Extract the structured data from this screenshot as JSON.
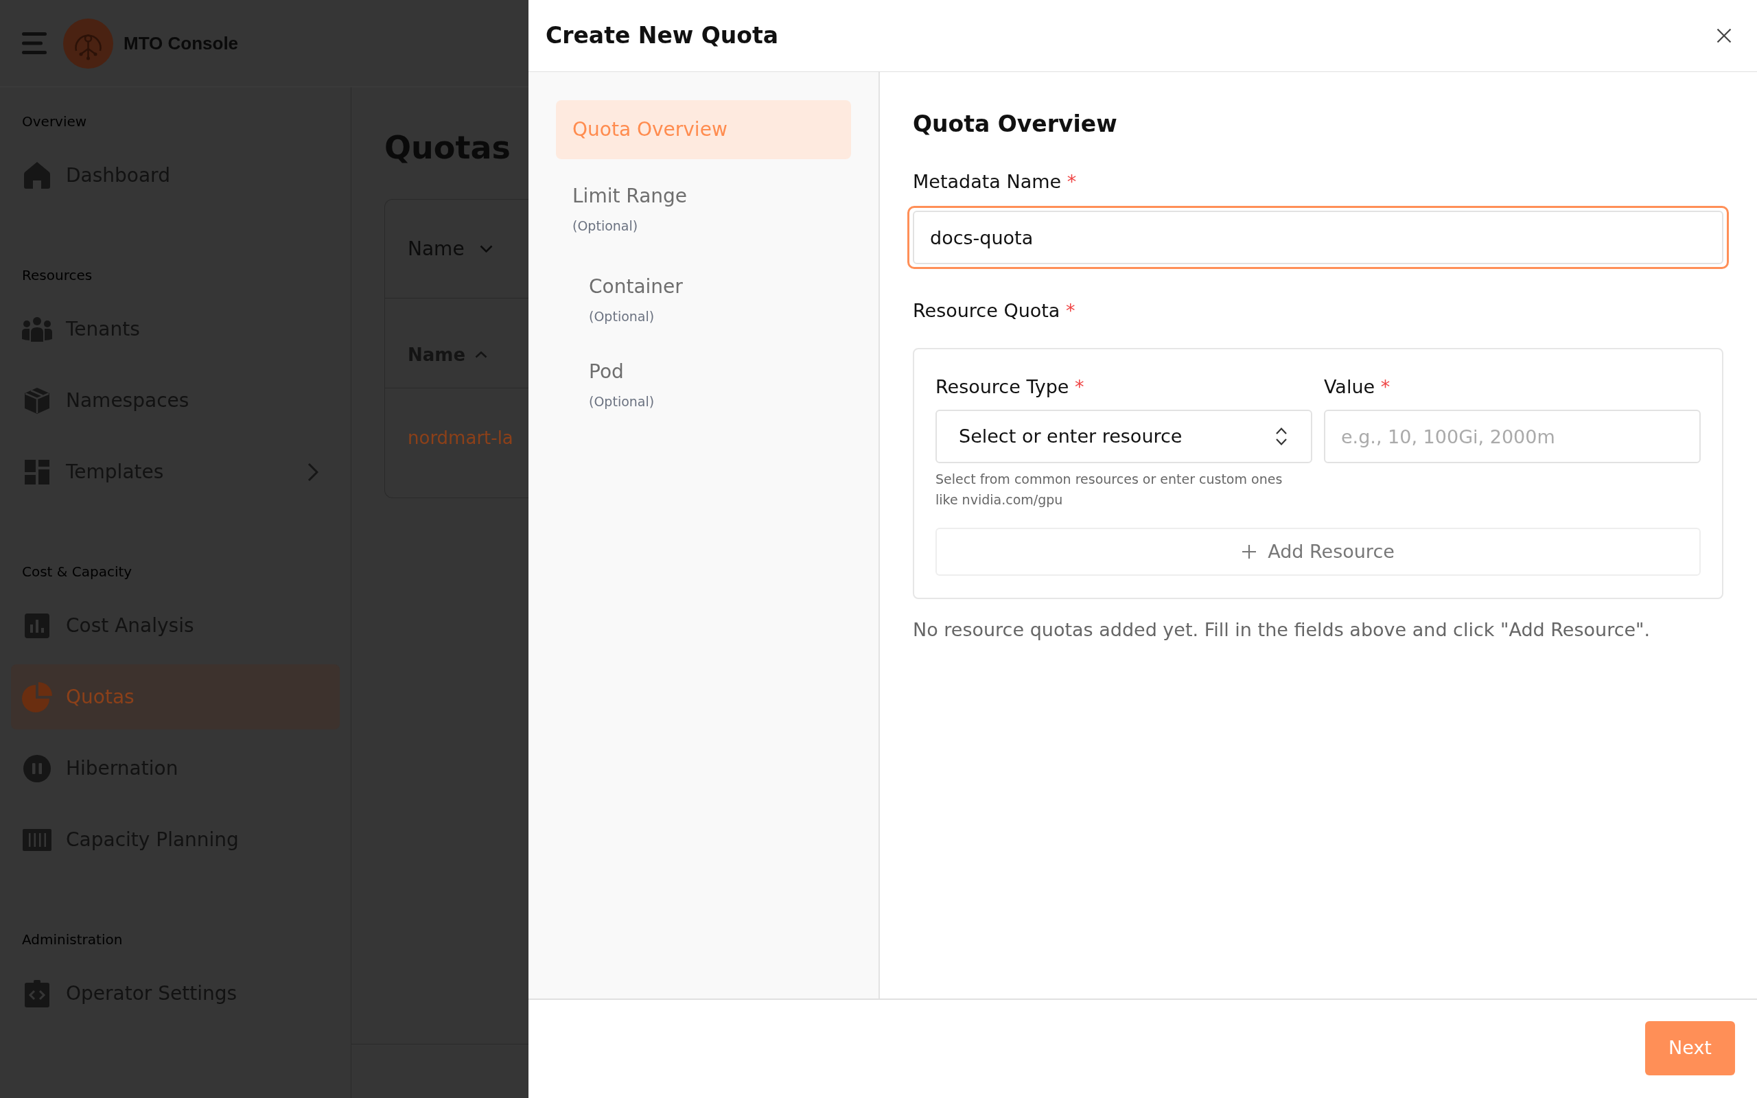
{
  "app_bar": {
    "title": "MTO Console"
  },
  "sidebar": {
    "sections": [
      {
        "heading": "Overview",
        "items": [
          {
            "label": "Dashboard",
            "kind": "link",
            "selected": false
          }
        ]
      },
      {
        "heading": "Resources",
        "items": [
          {
            "label": "Tenants",
            "kind": "link",
            "selected": false
          },
          {
            "label": "Namespaces",
            "kind": "link",
            "selected": false
          },
          {
            "label": "Templates",
            "kind": "group",
            "expanded": false,
            "selected": false
          }
        ]
      },
      {
        "heading": "Cost & Capacity",
        "items": [
          {
            "label": "Cost Analysis",
            "kind": "link",
            "selected": false
          },
          {
            "label": "Quotas",
            "kind": "link",
            "selected": true
          },
          {
            "label": "Hibernation",
            "kind": "link",
            "selected": false
          },
          {
            "label": "Capacity Planning",
            "kind": "link",
            "selected": false
          }
        ]
      },
      {
        "heading": "Administration",
        "items": [
          {
            "label": "Operator Settings",
            "kind": "link",
            "selected": false
          }
        ]
      }
    ]
  },
  "page": {
    "title": "Quotas",
    "filter": {
      "label": "Name"
    },
    "table": {
      "columns": [
        {
          "label": "Name",
          "sort_ascending": true
        }
      ],
      "rows": [
        {
          "name": "nordmart-la"
        }
      ]
    }
  },
  "drawer": {
    "title": "Create New Quota",
    "steps": [
      {
        "label": "Quota Overview",
        "selected": true
      },
      {
        "label": "Limit Range",
        "note": "(Optional)",
        "selected": false,
        "children": [
          {
            "label": "Container",
            "note": "(Optional)",
            "selected": false
          },
          {
            "label": "Pod",
            "note": "(Optional)",
            "selected": false
          }
        ]
      }
    ],
    "form": {
      "heading": "Quota Overview",
      "metadata_name": {
        "label": "Metadata Name",
        "required_mark": "*",
        "value": "docs-quota",
        "focused": true
      },
      "resource_quota": {
        "label": "Resource Quota",
        "required_mark": "*",
        "resource_type": {
          "label": "Resource Type",
          "required_mark": "*",
          "text": "Select or enter resource",
          "help": "Select from common resources or enter custom ones like nvidia.com/gpu"
        },
        "value": {
          "label": "Value",
          "required_mark": "*",
          "placeholder": "e.g., 10, 100Gi, 2000m"
        },
        "add_button": "Add Resource"
      },
      "empty_message": "No resource quotas added yet. Fill in the fields above and click \"Add Resource\"."
    },
    "footer": {
      "next_button": "Next"
    }
  }
}
